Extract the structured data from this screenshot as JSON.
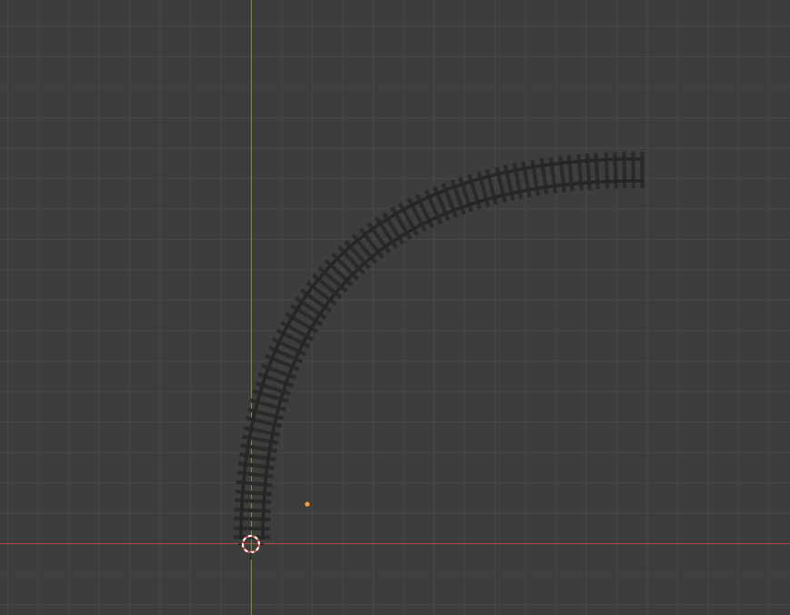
{
  "viewport": {
    "background": "#3d3d3d",
    "grid_minor_color": "#474747",
    "grid_major_color": "#4f4f4f",
    "x_axis_color": "#b34b4b",
    "y_axis_color": "#6b9a3c"
  },
  "scene": {
    "track_object": {
      "type": "curved-railway-track",
      "tie_color": "#2a2a2a",
      "rail_color": "#262626",
      "selected": false
    },
    "origin_point": {
      "color": "#ff9a2e"
    },
    "cursor_3d": {
      "ring_colors": [
        "#e04a3a",
        "#ffffff"
      ]
    }
  }
}
